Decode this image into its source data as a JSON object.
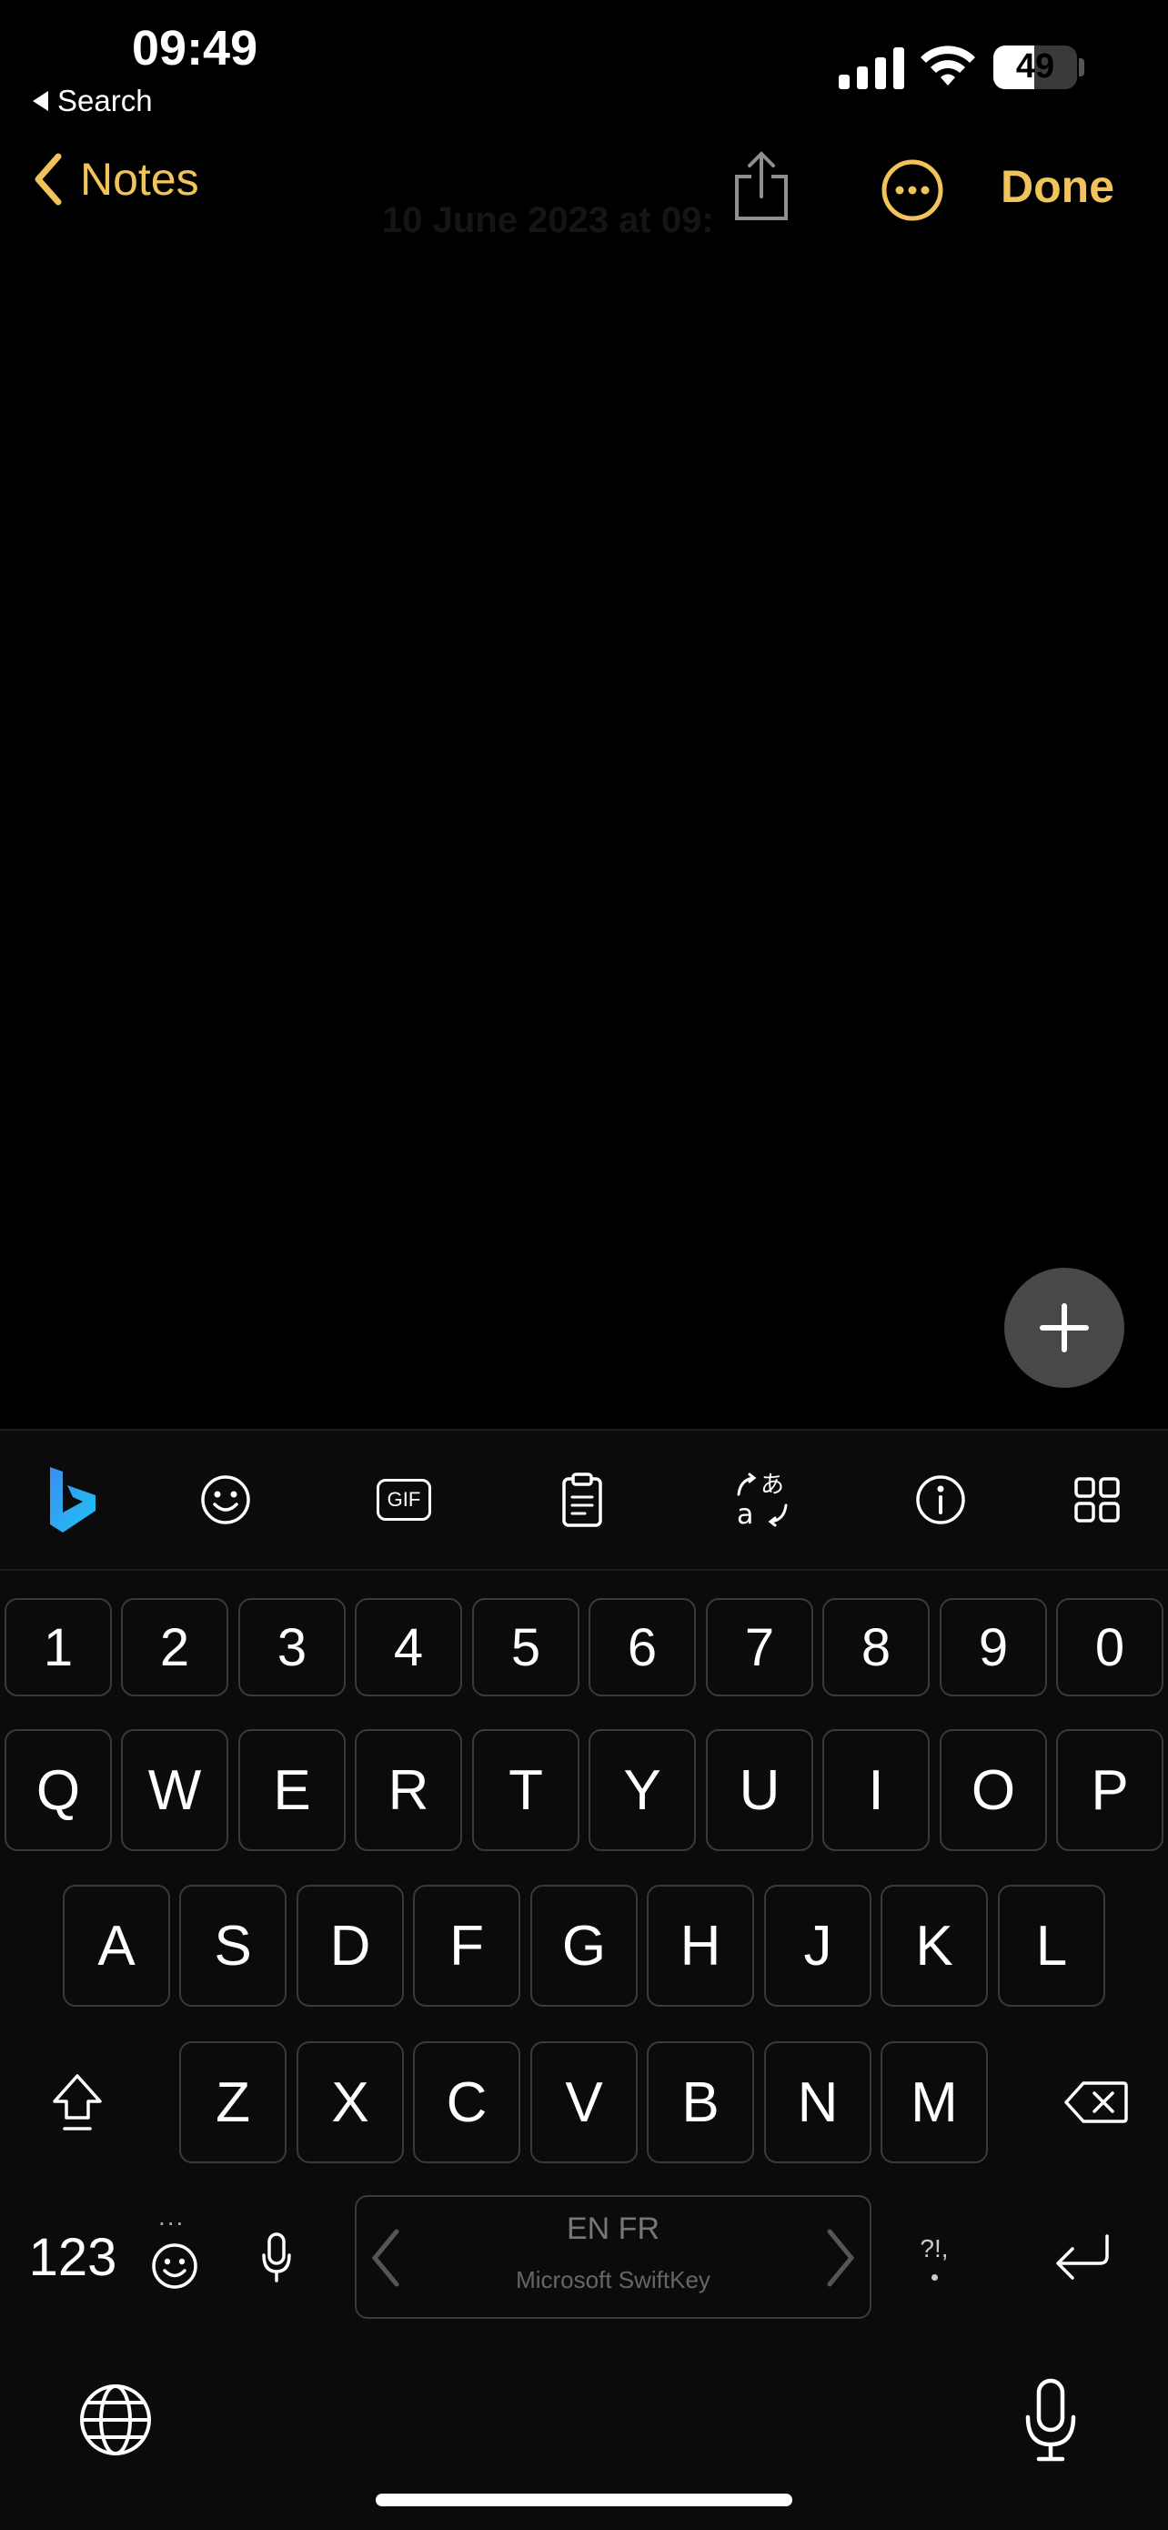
{
  "status_bar": {
    "time": "09:49",
    "back_app": "Search",
    "battery_percent": 49,
    "battery_text": "49"
  },
  "nav": {
    "back_label": "Notes",
    "done_label": "Done",
    "accent": "#f0c35b"
  },
  "note": {
    "faded_title": "10 June 2023 at 09:"
  },
  "toolbar": {
    "items": [
      "bing-icon",
      "emoji-icon",
      "gif-icon",
      "clipboard-icon",
      "translate-icon",
      "info-icon",
      "grid-icon"
    ],
    "gif_label": "GIF"
  },
  "keyboard": {
    "numbers": [
      "1",
      "2",
      "3",
      "4",
      "5",
      "6",
      "7",
      "8",
      "9",
      "0"
    ],
    "row1": [
      "Q",
      "W",
      "E",
      "R",
      "T",
      "Y",
      "U",
      "I",
      "O",
      "P"
    ],
    "row2": [
      "A",
      "S",
      "D",
      "F",
      "G",
      "H",
      "J",
      "K",
      "L"
    ],
    "row3": [
      "Z",
      "X",
      "C",
      "V",
      "B",
      "N",
      "M"
    ],
    "num_switch": "123",
    "space_languages": "EN FR",
    "space_brand": "Microsoft SwiftKey",
    "punct_label": "?!,",
    "emoji_dots": "..."
  }
}
